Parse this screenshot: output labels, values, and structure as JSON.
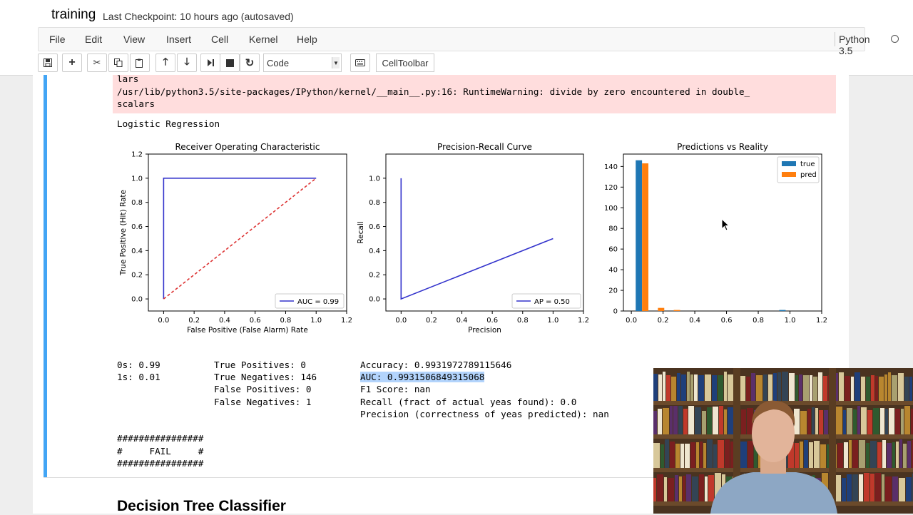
{
  "header": {
    "notebook_name": "training",
    "checkpoint": "Last Checkpoint: 10 hours ago (autosaved)"
  },
  "menu": [
    "File",
    "Edit",
    "View",
    "Insert",
    "Cell",
    "Kernel",
    "Help"
  ],
  "kernel": {
    "name": "Python 3.5"
  },
  "toolbar": {
    "icons": [
      "save-icon",
      "plus-icon",
      "cut-icon",
      "copy-icon",
      "paste-icon",
      "arrow-up-icon",
      "arrow-down-icon",
      "step-forward-icon",
      "stop-icon",
      "restart-icon",
      "keyboard-icon"
    ],
    "cell_type": "Code",
    "celltoolbar": "CellToolbar"
  },
  "output": {
    "stderr": [
      "lars",
      "/usr/lib/python3.5/site-packages/IPython/kernel/__main__.py:16: RuntimeWarning: divide by zero encountered in double_",
      "scalars"
    ],
    "model_title": "Logistic Regression",
    "stats_col1": [
      "0s: 0.99",
      "1s: 0.01"
    ],
    "stats_col2": [
      "True Positives: 0",
      "True Negatives: 146",
      "False Positives: 0",
      "False Negatives: 1"
    ],
    "accuracy": "Accuracy: 0.9931972789115646",
    "auc": "AUC: 0.9931506849315068",
    "stats_col3": [
      "F1 Score: nan",
      "Recall (fract of actual yeas found): 0.0",
      "Precision (correctness of yeas predicted): nan"
    ],
    "fail_box": [
      "################",
      "#     FAIL     #",
      "################"
    ]
  },
  "next_heading": "Decision Tree Classifier",
  "chart_data": [
    {
      "type": "line",
      "title": "Receiver Operating Characteristic",
      "xlabel": "False Positive (False Alarm) Rate",
      "ylabel": "True Positive (Hit) Rate",
      "xlim": [
        -0.1,
        1.2
      ],
      "ylim": [
        -0.1,
        1.2
      ],
      "xticks": [
        "0.0",
        "0.2",
        "0.4",
        "0.6",
        "0.8",
        "1.0",
        "1.2"
      ],
      "yticks": [
        "0.0",
        "0.2",
        "0.4",
        "0.6",
        "0.8",
        "1.0",
        "1.2"
      ],
      "series": [
        {
          "name": "AUC = 0.99",
          "color": "#3333cc",
          "x": [
            0,
            0,
            0,
            1
          ],
          "y": [
            0,
            0.007,
            1,
            1
          ]
        },
        {
          "color": "#dd3333",
          "dashed": true,
          "x": [
            0,
            1
          ],
          "y": [
            0,
            1
          ]
        }
      ],
      "legend": "lower right"
    },
    {
      "type": "line",
      "title": "Precision-Recall Curve",
      "xlabel": "Precision",
      "ylabel": "Recall",
      "xlim": [
        -0.1,
        1.2
      ],
      "ylim": [
        -0.1,
        1.2
      ],
      "xticks": [
        "0.0",
        "0.2",
        "0.4",
        "0.6",
        "0.8",
        "1.0",
        "1.2"
      ],
      "yticks": [
        "0.0",
        "0.2",
        "0.4",
        "0.6",
        "0.8",
        "1.0"
      ],
      "series": [
        {
          "name": "AP = 0.50",
          "color": "#3333cc",
          "x": [
            0,
            0,
            1
          ],
          "y": [
            1,
            0,
            0.5
          ]
        }
      ],
      "legend": "lower right"
    },
    {
      "type": "bar",
      "title": "Predictions vs Reality",
      "xlim": [
        -0.05,
        1.2
      ],
      "ylim": [
        0,
        152
      ],
      "xticks": [
        "0.0",
        "0.2",
        "0.4",
        "0.6",
        "0.8",
        "1.0",
        "1.2"
      ],
      "yticks": [
        "0",
        "20",
        "40",
        "60",
        "80",
        "100",
        "120",
        "140"
      ],
      "series": [
        {
          "name": "true",
          "color": "#1f77b4",
          "x": [
            0.0475,
            0.9525
          ],
          "values": [
            146,
            1
          ]
        },
        {
          "name": "pred",
          "color": "#ff7f0e",
          "x": [
            0.0875,
            0.1875,
            0.2875
          ],
          "values": [
            143,
            3,
            1
          ]
        }
      ],
      "bar_width": 0.04,
      "legend": "upper right"
    }
  ]
}
